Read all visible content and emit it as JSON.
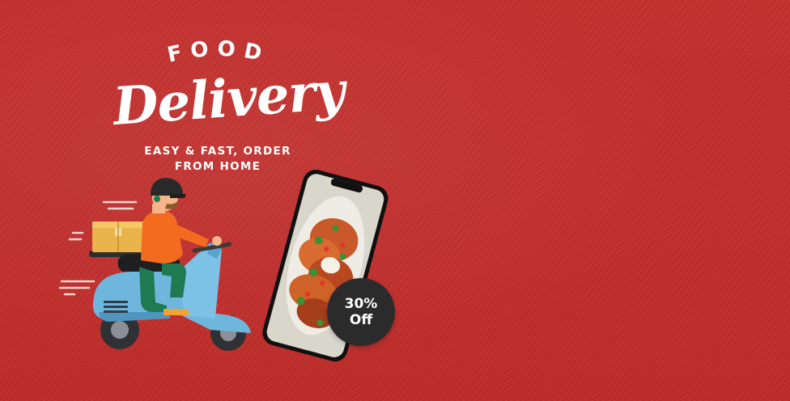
{
  "banner": {
    "heading_top": "FOOD",
    "heading_main": "Delivery",
    "tagline_line1": "EASY & FAST, ORDER",
    "tagline_line2": "FROM HOME",
    "discount": {
      "value": "30%",
      "label": "Off"
    }
  },
  "colors": {
    "background": "#c42f2c",
    "text": "#ffffff",
    "badge": "#2b2b2b",
    "scooter_body": "#6fb6dd",
    "rider_shirt": "#f26b1f",
    "rider_pants": "#1f7a52",
    "box": "#e9b44c"
  },
  "icons": {
    "illustration": "delivery-scooter-illustration",
    "phone": "smartphone-food-image"
  }
}
